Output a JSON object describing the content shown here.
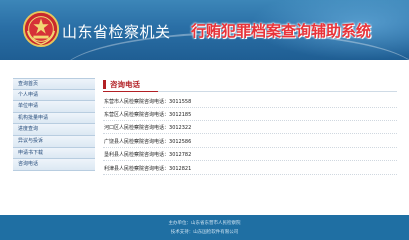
{
  "header": {
    "title_main": "山东省检察机关",
    "title_sub": "行贿犯罪档案查询辅助系统",
    "colors": {
      "bg": "#2a6fa6",
      "title_sub": "#e8343a"
    },
    "emblem_icon": "procuratorate-emblem-icon"
  },
  "sidebar": {
    "items": [
      {
        "label": "查询首页"
      },
      {
        "label": "个人申请"
      },
      {
        "label": "单位申请"
      },
      {
        "label": "机构批量申请"
      },
      {
        "label": "进度查询"
      },
      {
        "label": "异议与投诉"
      },
      {
        "label": "申请书下载"
      },
      {
        "label": "咨询电话"
      }
    ]
  },
  "content": {
    "title": "咨询电话",
    "accent": "#b21f24",
    "rows": [
      {
        "label": "东营市人民检察院咨询电话：",
        "phone": "3011558"
      },
      {
        "label": "东营区人民检察院咨询电话：",
        "phone": "3012185"
      },
      {
        "label": "河口区人民检察院咨询电话：",
        "phone": "3012322"
      },
      {
        "label": "广饶县人民检察院咨询电话：",
        "phone": "3012586"
      },
      {
        "label": "垦利县人民检察院咨询电话：",
        "phone": "3012782"
      },
      {
        "label": "利津县人民检察院咨询电话：",
        "phone": "3012821"
      }
    ]
  },
  "footer": {
    "line1": "主办单位：山东省东营市人民检察院",
    "line2": "技术支持：山东国检软件有限公司"
  }
}
